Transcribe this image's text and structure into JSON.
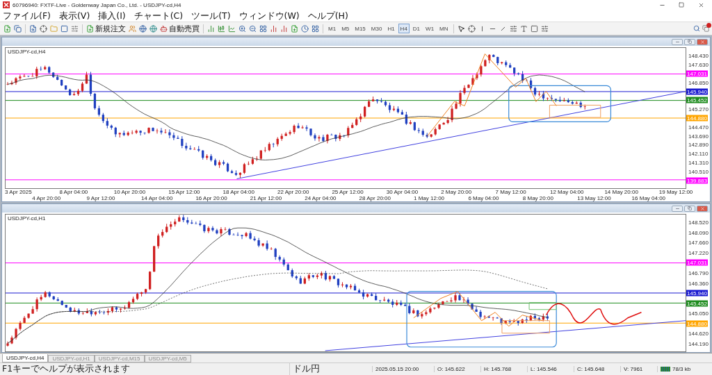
{
  "window": {
    "title": "60796940: FXTF-Live - Goldenway Japan Co., Ltd. - USDJPY-cd,H4"
  },
  "menu": [
    "ファイル(F)",
    "表示(V)",
    "挿入(I)",
    "チャート(C)",
    "ツール(T)",
    "ウィンドウ(W)",
    "ヘルプ(H)"
  ],
  "toolbar": {
    "order_button": "新規注文",
    "auto_trading_button": "自動売買",
    "timeframes": [
      {
        "label": "M1",
        "selected": false
      },
      {
        "label": "M5",
        "selected": false
      },
      {
        "label": "M15",
        "selected": false
      },
      {
        "label": "M30",
        "selected": false
      },
      {
        "label": "H1",
        "selected": false
      },
      {
        "label": "H4",
        "selected": true
      },
      {
        "label": "D1",
        "selected": false
      },
      {
        "label": "W1",
        "selected": false
      },
      {
        "label": "MN",
        "selected": false
      }
    ]
  },
  "charts": [
    {
      "label": "USDJPY-cd,H4",
      "axis": [
        {
          "kind": "tick",
          "label": "148.430"
        },
        {
          "kind": "tick",
          "label": "147.630"
        },
        {
          "kind": "level",
          "label": "147.031",
          "color": "#ff00ff"
        },
        {
          "kind": "tick",
          "label": "146.850"
        },
        {
          "kind": "level",
          "label": "145.940",
          "color": "#1a1ad0"
        },
        {
          "kind": "level",
          "label": "145.452",
          "color": "#1e8c1e"
        },
        {
          "kind": "tick",
          "label": "145.270"
        },
        {
          "kind": "level",
          "label": "144.880",
          "color": "#ffa500"
        },
        {
          "kind": "tick",
          "label": "144.470"
        },
        {
          "kind": "tick",
          "label": "143.690"
        },
        {
          "kind": "tick",
          "label": "142.890"
        },
        {
          "kind": "tick",
          "label": "142.110"
        },
        {
          "kind": "tick",
          "label": "141.310"
        },
        {
          "kind": "tick",
          "label": "140.510"
        },
        {
          "kind": "level",
          "label": "139.883",
          "color": "#ff00ff"
        }
      ],
      "time_axis": [
        "3 Apr 2025",
        "4 Apr 20:00",
        "8 Apr 04:00",
        "9 Apr 12:00",
        "10 Apr 20:00",
        "14 Apr 04:00",
        "15 Apr 12:00",
        "16 Apr 20:00",
        "18 Apr 04:00",
        "21 Apr 12:00",
        "22 Apr 20:00",
        "24 Apr 04:00",
        "25 Apr 12:00",
        "28 Apr 20:00",
        "30 Apr 04:00",
        "1 May 12:00",
        "2 May 20:00",
        "6 May 04:00",
        "7 May 12:00",
        "8 May 20:00",
        "12 May 04:00",
        "13 May 12:00",
        "14 May 20:00",
        "16 May 04:00",
        "19 May 12:00"
      ]
    },
    {
      "label": "USDJPY-cd,H1",
      "axis": [
        {
          "kind": "tick",
          "label": "148.520"
        },
        {
          "kind": "tick",
          "label": "148.090"
        },
        {
          "kind": "tick",
          "label": "147.660"
        },
        {
          "kind": "tick",
          "label": "147.220"
        },
        {
          "kind": "level",
          "label": "147.031",
          "color": "#ff00ff"
        },
        {
          "kind": "tick",
          "label": "146.790"
        },
        {
          "kind": "tick",
          "label": "146.360"
        },
        {
          "kind": "level",
          "label": "145.940",
          "color": "#1a1ad0"
        },
        {
          "kind": "level",
          "label": "145.452",
          "color": "#1e8c1e"
        },
        {
          "kind": "tick",
          "label": "145.050"
        },
        {
          "kind": "level",
          "label": "144.880",
          "color": "#ffa500"
        },
        {
          "kind": "tick",
          "label": "144.620"
        },
        {
          "kind": "tick",
          "label": "144.190"
        }
      ]
    }
  ],
  "tabs": [
    {
      "label": "USDJPY-cd,H4",
      "selected": true
    },
    {
      "label": "USDJPY-cd,H1",
      "selected": false
    },
    {
      "label": "USDJPY-cd,M15",
      "selected": false
    },
    {
      "label": "USDJPY-cd,M5",
      "selected": false
    }
  ],
  "status_bar": {
    "help": "F1キーでヘルプが表示されます",
    "profile": "ドル円",
    "time": "2025.05.15 20:00",
    "open": "O: 145.622",
    "high": "H: 145.768",
    "low": "L: 145.546",
    "close": "C: 145.648",
    "volume": "V: 7961",
    "traffic": "78/3 kb"
  }
}
